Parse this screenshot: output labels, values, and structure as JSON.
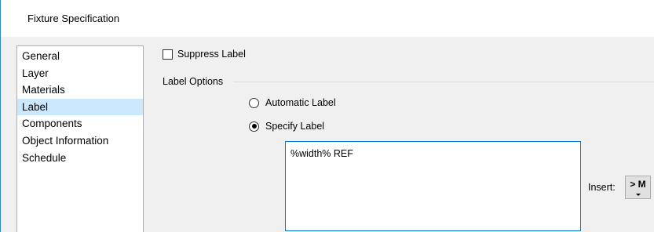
{
  "window": {
    "title": "Fixture Specification",
    "accent_color": "#0078d7"
  },
  "sidebar": {
    "items": [
      {
        "label": "General",
        "selected": false
      },
      {
        "label": "Layer",
        "selected": false
      },
      {
        "label": "Materials",
        "selected": false
      },
      {
        "label": "Label",
        "selected": true
      },
      {
        "label": "Components",
        "selected": false
      },
      {
        "label": "Object Information",
        "selected": false
      },
      {
        "label": "Schedule",
        "selected": false
      }
    ],
    "selected_color": "#cce8ff"
  },
  "label_panel": {
    "suppress_label": {
      "label": "Suppress Label",
      "checked": false
    },
    "group_title": "Label Options",
    "automatic_label": {
      "label": "Automatic Label",
      "selected": false
    },
    "specify_label": {
      "label": "Specify Label",
      "selected": true
    },
    "label_text_value": "%width% REF",
    "insert_label": "Insert:",
    "insert_button_label": "> M"
  }
}
